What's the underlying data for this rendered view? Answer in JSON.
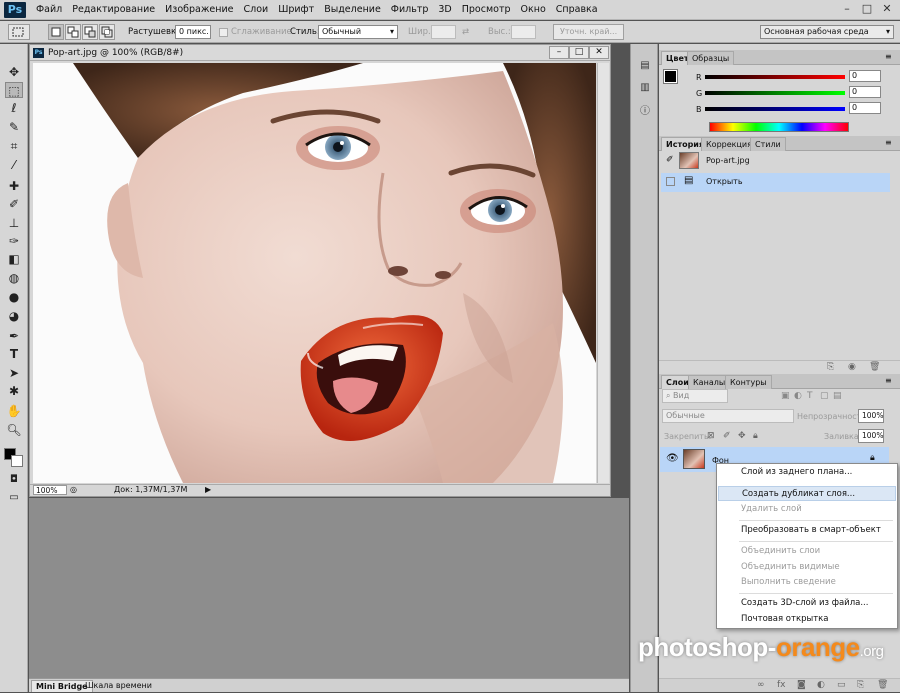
{
  "app": {
    "logo": "Ps"
  },
  "menu": [
    "Файл",
    "Редактирование",
    "Изображение",
    "Слои",
    "Шрифт",
    "Выделение",
    "Фильтр",
    "3D",
    "Просмотр",
    "Окно",
    "Справка"
  ],
  "window_controls": [
    "–",
    "□",
    "✕"
  ],
  "options_bar": {
    "feather_label": "Растушевка:",
    "feather_value": "0 пикс.",
    "antialias_label": "Сглаживание",
    "style_label": "Стиль:",
    "style_value": "Обычный",
    "width_label": "Шир.:",
    "height_label": "Выс.:",
    "refine_edge_button": "Уточн. край...",
    "workspace_value": "Основная рабочая среда"
  },
  "document": {
    "title": "Pop-art.jpg @ 100% (RGB/8#)",
    "zoom": "100%",
    "doc_info": "Док: 1,37M/1,37M",
    "controls": [
      "–",
      "□",
      "✕"
    ]
  },
  "bottom_tabs": [
    "Mini Bridge",
    "Шкала времени"
  ],
  "color_panel": {
    "tabs": [
      "Цвет",
      "Образцы"
    ],
    "channels": [
      {
        "label": "R",
        "value": "0"
      },
      {
        "label": "G",
        "value": "0"
      },
      {
        "label": "B",
        "value": "0"
      }
    ]
  },
  "history_panel": {
    "tabs": [
      "История",
      "Коррекция",
      "Стили"
    ],
    "snapshot": "Pop-art.jpg",
    "step": "Открыть"
  },
  "layers_panel": {
    "tabs": [
      "Слои",
      "Каналы",
      "Контуры"
    ],
    "filter_value": "Вид",
    "blend_mode": "Обычные",
    "opacity_label": "Непрозрачность:",
    "opacity_value": "100%",
    "lock_label": "Закрепить:",
    "fill_label": "Заливка:",
    "fill_value": "100%",
    "layer_name": "Фон"
  },
  "context_menu": {
    "items": [
      {
        "label": "Слой из заднего плана...",
        "enabled": true
      },
      {
        "label": "Создать дубликат слоя...",
        "enabled": true,
        "highlighted": true
      },
      {
        "label": "Удалить слой",
        "enabled": false
      },
      {
        "label": "Преобразовать в смарт-объект",
        "enabled": true
      },
      {
        "label": "Объединить слои",
        "enabled": false
      },
      {
        "label": "Объединить видимые",
        "enabled": false
      },
      {
        "label": "Выполнить сведение",
        "enabled": false
      },
      {
        "label": "Создать 3D-слой из файла...",
        "enabled": true
      },
      {
        "label": "Почтовая открытка",
        "enabled": true
      }
    ]
  },
  "watermark": {
    "part1": "photoshop-",
    "part2": "orange",
    "part3": ".org"
  },
  "colors": {
    "accent_orange": "#f48a1c",
    "selection_blue": "#b9d5f7",
    "lips": "#d23a1c"
  }
}
